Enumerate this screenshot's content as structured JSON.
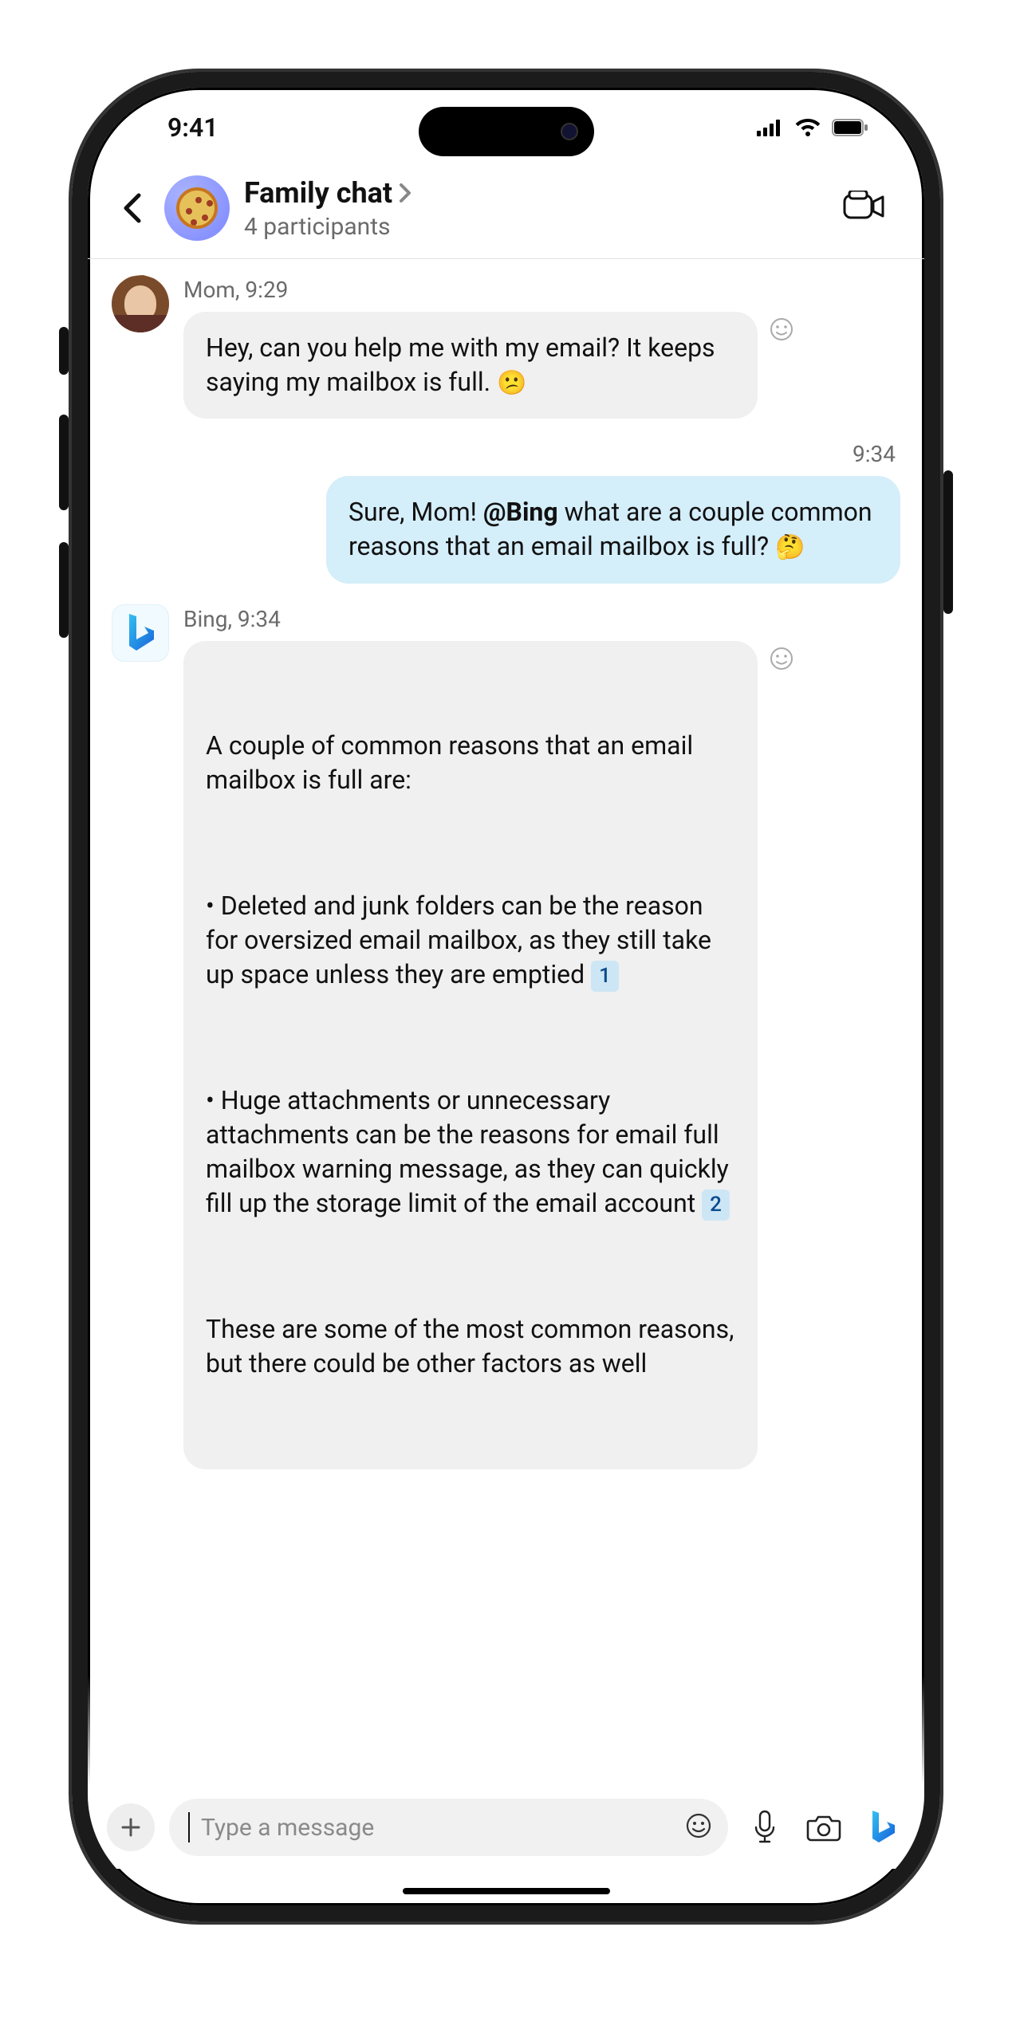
{
  "status": {
    "time": "9:41"
  },
  "header": {
    "chat_title": "Family chat",
    "participants": "4 participants"
  },
  "messages": {
    "mom": {
      "meta": "Mom, 9:29",
      "text": "Hey, can you help me with my email? It keeps saying my mailbox is full. ",
      "emoji": "😕"
    },
    "self": {
      "meta": "9:34",
      "pre": "Sure, Mom! ",
      "bold": "@Bing",
      "post": " what are a couple common reasons that an email mailbox is full? ",
      "emoji": "🤔"
    },
    "bing": {
      "meta": "Bing, 9:34",
      "p1": "A couple of common reasons that an email mailbox is full are:",
      "p2a": "• Deleted and junk folders can be the reason for oversized email mailbox, as they still take up space unless they are emptied ",
      "cite1": "1",
      "p3a": "• Huge attachments or unnecessary attachments can be the reasons for email full mailbox warning message, as they can quickly fill up the storage limit of the email account ",
      "cite2": "2",
      "p4": "These are some of the most common reasons, but there could be other factors as well"
    }
  },
  "composer": {
    "placeholder": "Type a message"
  }
}
